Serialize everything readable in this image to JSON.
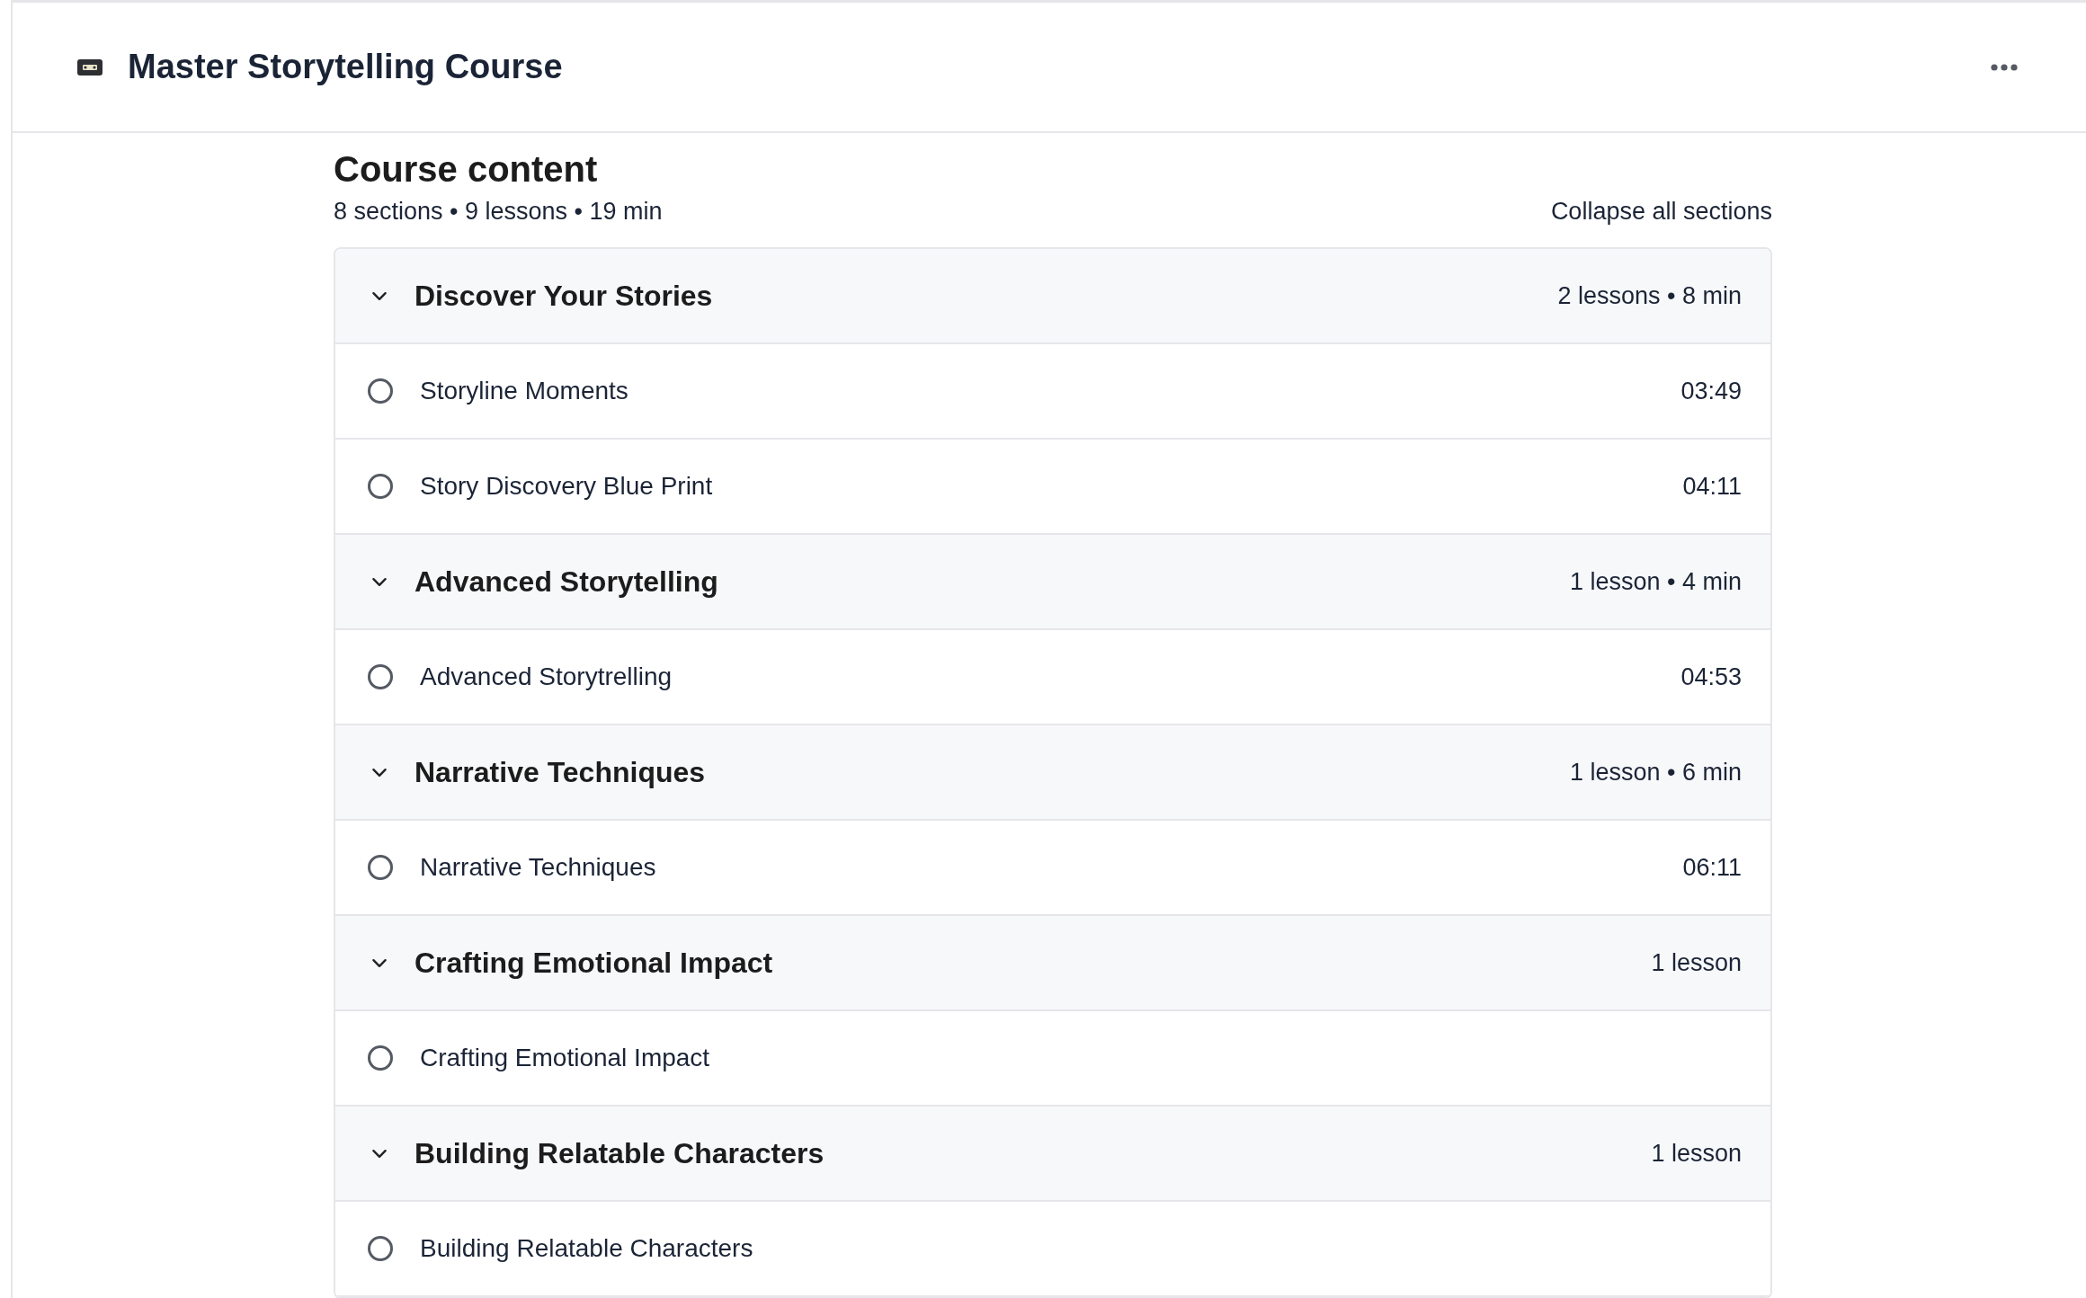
{
  "header": {
    "title": "Master Storytelling Course"
  },
  "course": {
    "heading": "Course content",
    "summary": "8 sections • 9 lessons • 19 min",
    "collapse_link": "Collapse all sections"
  },
  "sections": [
    {
      "title": "Discover Your Stories",
      "meta": "2 lessons • 8 min",
      "expanded": true,
      "lessons": [
        {
          "title": "Storyline Moments",
          "duration": "03:49",
          "completed": false
        },
        {
          "title": "Story Discovery Blue Print",
          "duration": "04:11",
          "completed": false
        }
      ]
    },
    {
      "title": "Advanced Storytelling",
      "meta": "1 lesson • 4 min",
      "expanded": true,
      "lessons": [
        {
          "title": "Advanced Storytrelling",
          "duration": "04:53",
          "completed": false
        }
      ]
    },
    {
      "title": "Narrative Techniques",
      "meta": "1 lesson • 6 min",
      "expanded": true,
      "lessons": [
        {
          "title": "Narrative Techniques",
          "duration": "06:11",
          "completed": false
        }
      ]
    },
    {
      "title": "Crafting Emotional Impact",
      "meta": "1 lesson",
      "expanded": true,
      "lessons": [
        {
          "title": "Crafting Emotional Impact",
          "completed": false
        }
      ]
    },
    {
      "title": "Building Relatable Characters",
      "meta": "1 lesson",
      "expanded": true,
      "lessons": [
        {
          "title": "Building Relatable Characters",
          "completed": false
        }
      ]
    }
  ]
}
